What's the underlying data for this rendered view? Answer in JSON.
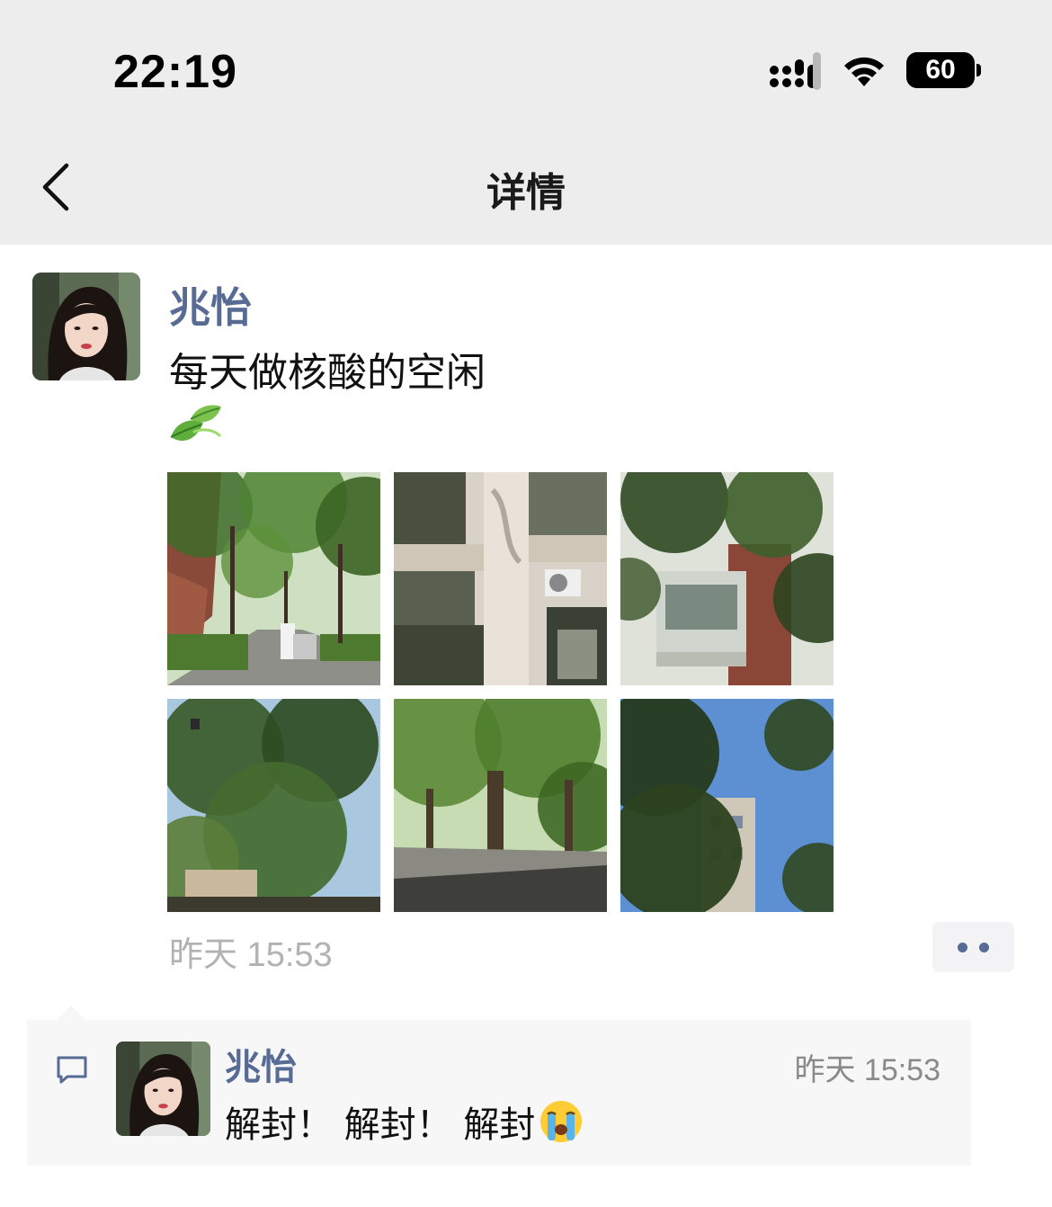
{
  "status_bar": {
    "time": "22:19",
    "battery": "60",
    "icons": [
      "signal-icon",
      "wifi-icon",
      "battery-icon"
    ]
  },
  "nav": {
    "title": "详情",
    "back_icon": "chevron-left-icon"
  },
  "post": {
    "author": "兆怡",
    "text": "每天做核酸的空闲",
    "emoji": "leaf-icon",
    "photos": [
      {
        "name": "photo-street-with-workers"
      },
      {
        "name": "photo-building-balconies"
      },
      {
        "name": "photo-balcony-and-trees"
      },
      {
        "name": "photo-tree-canopy-sky"
      },
      {
        "name": "photo-park-trees"
      },
      {
        "name": "photo-trees-and-building"
      }
    ],
    "timestamp": "昨天 15:53"
  },
  "comments": [
    {
      "author": "兆怡",
      "time": "昨天 15:53",
      "text": "解封！ 解封！ 解封",
      "emoji": "crying-face-icon"
    }
  ],
  "colors": {
    "nav_bg": "#ededed",
    "link_blue": "#576b95",
    "comment_bg": "#f7f7f7",
    "timestamp_gray": "#b2b2b2"
  }
}
